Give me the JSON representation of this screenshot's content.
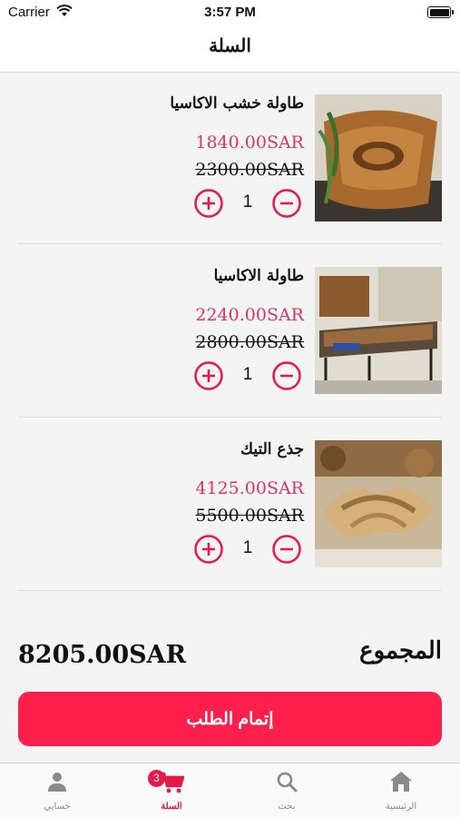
{
  "status_bar": {
    "carrier": "Carrier",
    "time": "3:57 PM"
  },
  "nav": {
    "title": "السلة"
  },
  "cart": {
    "items": [
      {
        "name": "طاولة خشب الاكاسيا",
        "price": "1840.00SAR",
        "old_price": "2300.00SAR",
        "quantity": "1",
        "image": "acacia-wood-table-photo"
      },
      {
        "name": "طاولة الاكاسيا",
        "price": "2240.00SAR",
        "old_price": "2800.00SAR",
        "quantity": "1",
        "image": "acacia-table-photo"
      },
      {
        "name": "جذع التيك",
        "price": "4125.00SAR",
        "old_price": "5500.00SAR",
        "quantity": "1",
        "image": "teak-trunk-photo"
      }
    ],
    "total_label": "المجموع",
    "total_value": "8205.00SAR",
    "checkout_label": "إتمام الطلب"
  },
  "colors": {
    "accent": "#e8194a",
    "checkout": "#ff1f4c",
    "price": "#e03363"
  },
  "tabs": [
    {
      "label": "حسابي",
      "icon": "person-icon"
    },
    {
      "label": "السلة",
      "icon": "cart-icon",
      "badge": "3",
      "active": true
    },
    {
      "label": "بحث",
      "icon": "search-icon"
    },
    {
      "label": "الرئيسية",
      "icon": "home-icon"
    }
  ]
}
